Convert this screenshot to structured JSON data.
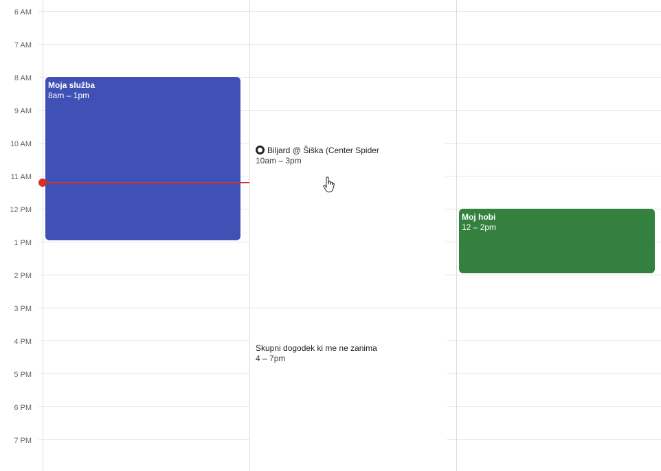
{
  "time_axis": {
    "labels": [
      "6 AM",
      "7 AM",
      "8 AM",
      "9 AM",
      "10 AM",
      "11 AM",
      "12 PM",
      "1 PM",
      "2 PM",
      "3 PM",
      "4 PM",
      "5 PM",
      "6 PM",
      "7 PM"
    ]
  },
  "events": {
    "moja_sluzba": {
      "title": "Moja služba",
      "time": "8am – 1pm",
      "color": "#3f51b5"
    },
    "biljard": {
      "emoji_icon": "8-ball-icon",
      "title": "Biljard @ Šiška (Center Spider",
      "time": "10am – 3pm"
    },
    "skupni": {
      "title": "Skupni dogodek ki me ne zanima",
      "time": "4 – 7pm"
    },
    "moj_hobi": {
      "title": "Moj hobi",
      "time": "12 – 2pm",
      "color": "#33803f"
    }
  },
  "now_indicator": {
    "color": "#d93025"
  }
}
